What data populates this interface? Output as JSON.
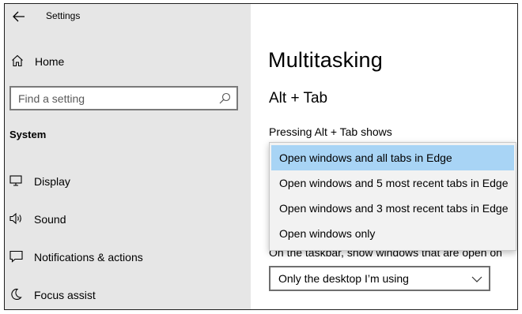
{
  "window": {
    "title": "Settings"
  },
  "sidebar": {
    "home_label": "Home",
    "search_placeholder": "Find a setting",
    "section": "System",
    "items": [
      {
        "label": "Display",
        "icon": "display-icon"
      },
      {
        "label": "Sound",
        "icon": "sound-icon"
      },
      {
        "label": "Notifications & actions",
        "icon": "notifications-icon"
      },
      {
        "label": "Focus assist",
        "icon": "focus-assist-icon"
      }
    ]
  },
  "main": {
    "title": "Multitasking",
    "alt_tab": {
      "heading": "Alt + Tab",
      "label": "Pressing Alt + Tab shows",
      "options": [
        "Open windows and all tabs in Edge",
        "Open windows and 5 most recent tabs in Edge",
        "Open windows and 3 most recent tabs in Edge",
        "Open windows only"
      ],
      "selected_index": 0
    },
    "taskbar": {
      "label": "On the taskbar, show windows that are open on",
      "value": "Only the desktop I’m using"
    }
  },
  "colors": {
    "sidebar_bg": "#e6e6e6",
    "selected_option": "#a8d4f5",
    "dropdown_bg": "#f2f2f2"
  }
}
